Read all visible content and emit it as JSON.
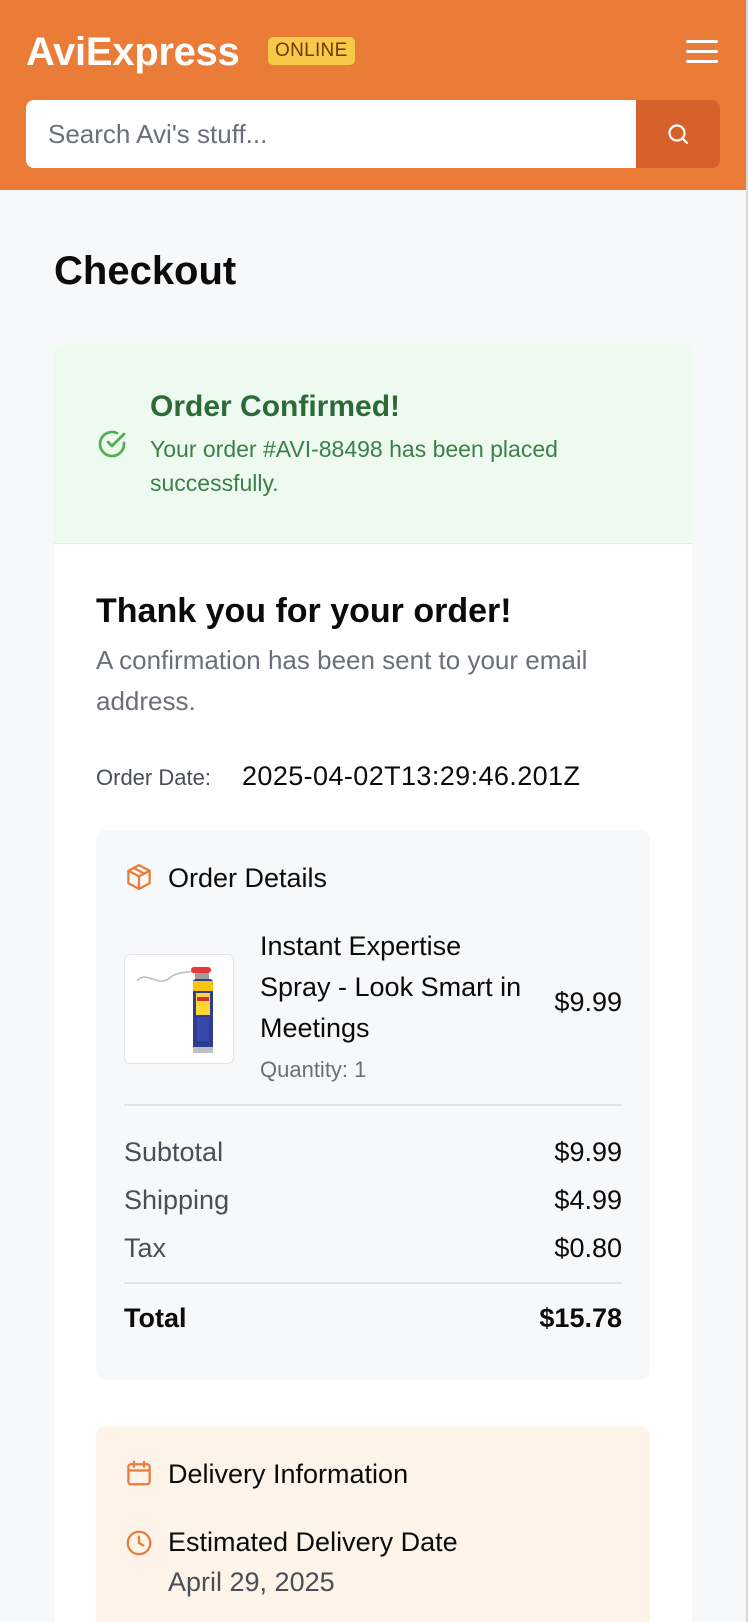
{
  "header": {
    "brand": "AviExpress",
    "badge": "ONLINE",
    "search_placeholder": "Search Avi's stuff...",
    "brand_color": "#ea7c38",
    "search_button_color": "#d6612a"
  },
  "page": {
    "title": "Checkout"
  },
  "confirmation": {
    "title": "Order Confirmed!",
    "message": "Your order #AVI-88498 has been placed successfully."
  },
  "thanks": {
    "title": "Thank you for your order!",
    "message": "A confirmation has been sent to your email address.",
    "order_date_label": "Order Date:",
    "order_date_value": "2025-04-02T13:29:46.201Z"
  },
  "order_details": {
    "heading": "Order Details",
    "item": {
      "name": "Instant Expertise Spray - Look Smart in Meetings",
      "quantity": "Quantity: 1",
      "price": "$9.99"
    },
    "summary": [
      {
        "label": "Subtotal",
        "value": "$9.99"
      },
      {
        "label": "Shipping",
        "value": "$4.99"
      },
      {
        "label": "Tax",
        "value": "$0.80"
      }
    ],
    "total": {
      "label": "Total",
      "value": "$15.78"
    }
  },
  "delivery": {
    "heading": "Delivery Information",
    "estimated_label": "Estimated Delivery Date",
    "estimated_value": "April 29, 2025"
  }
}
